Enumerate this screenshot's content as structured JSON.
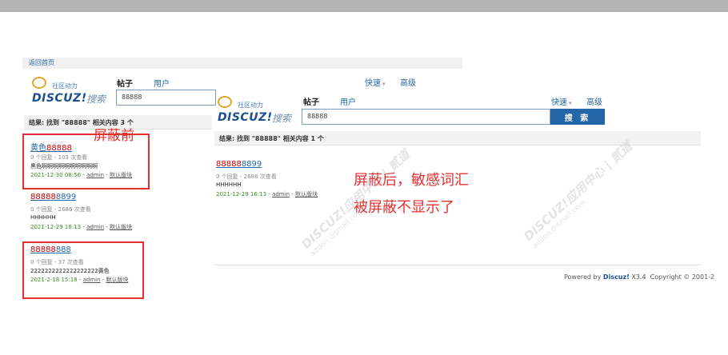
{
  "left": {
    "strip_text": "返回首页",
    "logo": {
      "cn": "社区动力",
      "brand": "DISCUZ!",
      "search": "搜索"
    },
    "tabs": {
      "posts": "帖子",
      "users": "用户"
    },
    "search_value": "88888",
    "quick": "快速",
    "advanced": "高级",
    "result": "结果: 找到 \"88888\" 相关内容 3 个",
    "items": [
      {
        "title_a": "黄色",
        "title_b": "88888",
        "meta": "0 个回复 - 103 次查看",
        "content": "黑色啊啊啊啊啊啊啊啊啊啊",
        "date": "2021-12-30 08:56",
        "author": "admin",
        "dash": " - ",
        "board": "默认版块"
      },
      {
        "title_a": "88888",
        "title_b": "8899",
        "meta": "0 个回复 - 2686 次查看",
        "content": "HHHHHH",
        "date": "2021-12-29 16:13",
        "author": "admin",
        "dash": " - ",
        "board": "默认版块"
      },
      {
        "title_a": "88888",
        "title_b": "888",
        "meta": "0 个回复 - 37 次查看",
        "content": "2222222222222222222黄色",
        "date": "2021-2-18 15:18",
        "author": "admin",
        "dash": " - ",
        "board": "默认版块"
      }
    ],
    "label_before": "屏蔽前"
  },
  "right": {
    "logo": {
      "cn": "社区动力",
      "brand": "DISCUZ!",
      "search": "搜索"
    },
    "tabs": {
      "posts": "帖子",
      "users": "用户"
    },
    "quick": "快速",
    "advanced": "高级",
    "search_value": "88888",
    "search_button": "搜 索",
    "result": "结果: 找到 \"88888\" 相关内容 1 个",
    "item": {
      "title_a": "88888",
      "title_b": "8899",
      "meta": "0 个回复 - 2686 次查看",
      "content": "HHHHHH",
      "date": "2021-12-29 16:13",
      "author": "admin",
      "dash": " - ",
      "board": "默认版块"
    },
    "label_after_line1": "屏蔽后，敏感词汇",
    "label_after_line2": "被屏蔽不显示了",
    "footer_prefix": "Powered by ",
    "footer_brand": "Discuz!",
    "footer_version": " X3.4",
    "footer_copy": "Copyright © 2001-2"
  },
  "watermark": {
    "main": "DISCUZ!应用中心 | 贰道",
    "sub": "addon.dismall.com"
  },
  "colors": {
    "link": "#2366a8",
    "highlight": "#cc0000",
    "annotation": "#e53030",
    "date": "#3c8b21",
    "button": "#2366a8"
  }
}
